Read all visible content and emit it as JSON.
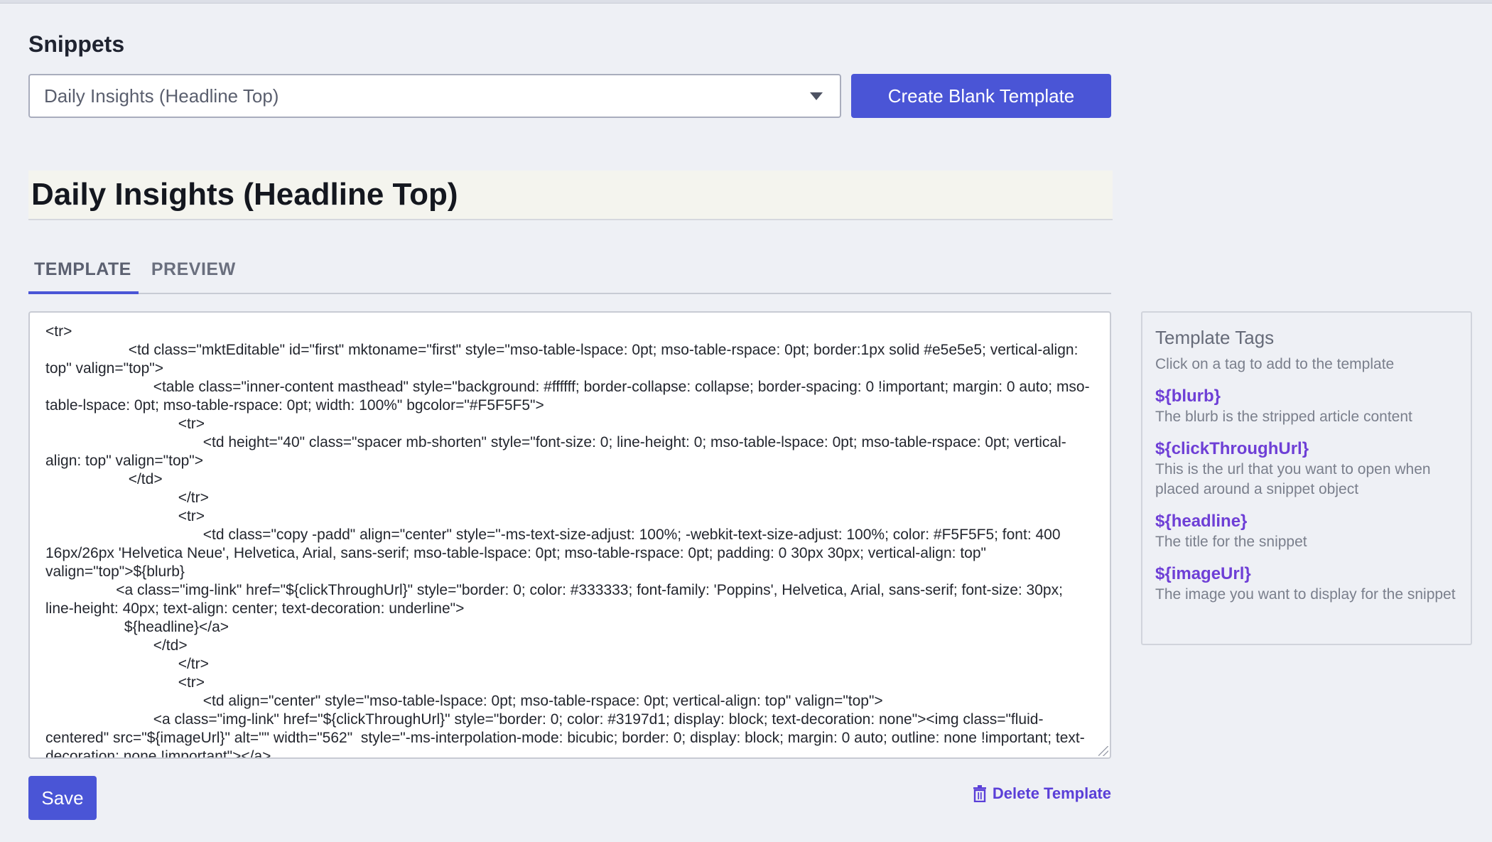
{
  "snippets": {
    "section_title": "Snippets",
    "selected": "Daily Insights (Headline Top)",
    "create_button": "Create Blank Template"
  },
  "template": {
    "name": "Daily Insights (Headline Top)",
    "tabs": [
      {
        "label": "TEMPLATE",
        "active": true
      },
      {
        "label": "PREVIEW",
        "active": false
      }
    ],
    "code": "<tr>\n                    <td class=\"mktEditable\" id=\"first\" mktoname=\"first\" style=\"mso-table-lspace: 0pt; mso-table-rspace: 0pt; border:1px solid #e5e5e5; vertical-align: top\" valign=\"top\">\n                          <table class=\"inner-content masthead\" style=\"background: #ffffff; border-collapse: collapse; border-spacing: 0 !important; margin: 0 auto; mso-table-lspace: 0pt; mso-table-rspace: 0pt; width: 100%\" bgcolor=\"#F5F5F5\">\n                                <tr>\n                                      <td height=\"40\" class=\"spacer mb-shorten\" style=\"font-size: 0; line-height: 0; mso-table-lspace: 0pt; mso-table-rspace: 0pt; vertical-align: top\" valign=\"top\">\n                    </td>\n                                </tr>\n                                <tr>\n                                      <td class=\"copy -padd\" align=\"center\" style=\"-ms-text-size-adjust: 100%; -webkit-text-size-adjust: 100%; color: #F5F5F5; font: 400 16px/26px 'Helvetica Neue', Helvetica, Arial, sans-serif; mso-table-lspace: 0pt; mso-table-rspace: 0pt; padding: 0 30px 30px; vertical-align: top\" valign=\"top\">${blurb}\n                 <a class=\"img-link\" href=\"${clickThroughUrl}\" style=\"border: 0; color: #333333; font-family: 'Poppins', Helvetica, Arial, sans-serif; font-size: 30px; line-height: 40px; text-align: center; text-decoration: underline\">\n                   ${headline}</a>\n                          </td>\n                                </tr>\n                                <tr>\n                                      <td align=\"center\" style=\"mso-table-lspace: 0pt; mso-table-rspace: 0pt; vertical-align: top\" valign=\"top\">\n                          <a class=\"img-link\" href=\"${clickThroughUrl}\" style=\"border: 0; color: #3197d1; display: block; text-decoration: none\"><img class=\"fluid-centered\" src=\"${imageUrl}\" alt=\"\" width=\"562\"  style=\"-ms-interpolation-mode: bicubic; border: 0; display: block; margin: 0 auto; outline: none !important; text-decoration: none !important\"></a>",
    "save_button": "Save",
    "delete_link": "Delete Template"
  },
  "tags_panel": {
    "title": "Template Tags",
    "subtitle": "Click on a tag to add to the template",
    "tags": [
      {
        "name": "${blurb}",
        "description": "The blurb is the stripped article content"
      },
      {
        "name": "${clickThroughUrl}",
        "description": "This is the url that you want to open when placed around a snippet object"
      },
      {
        "name": "${headline}",
        "description": "The title for the snippet"
      },
      {
        "name": "${imageUrl}",
        "description": "The image you want to display for the snippet"
      }
    ]
  },
  "colors": {
    "accent": "#4a55d6",
    "tag_purple": "#6e3fd6",
    "background": "#eef0f5"
  }
}
